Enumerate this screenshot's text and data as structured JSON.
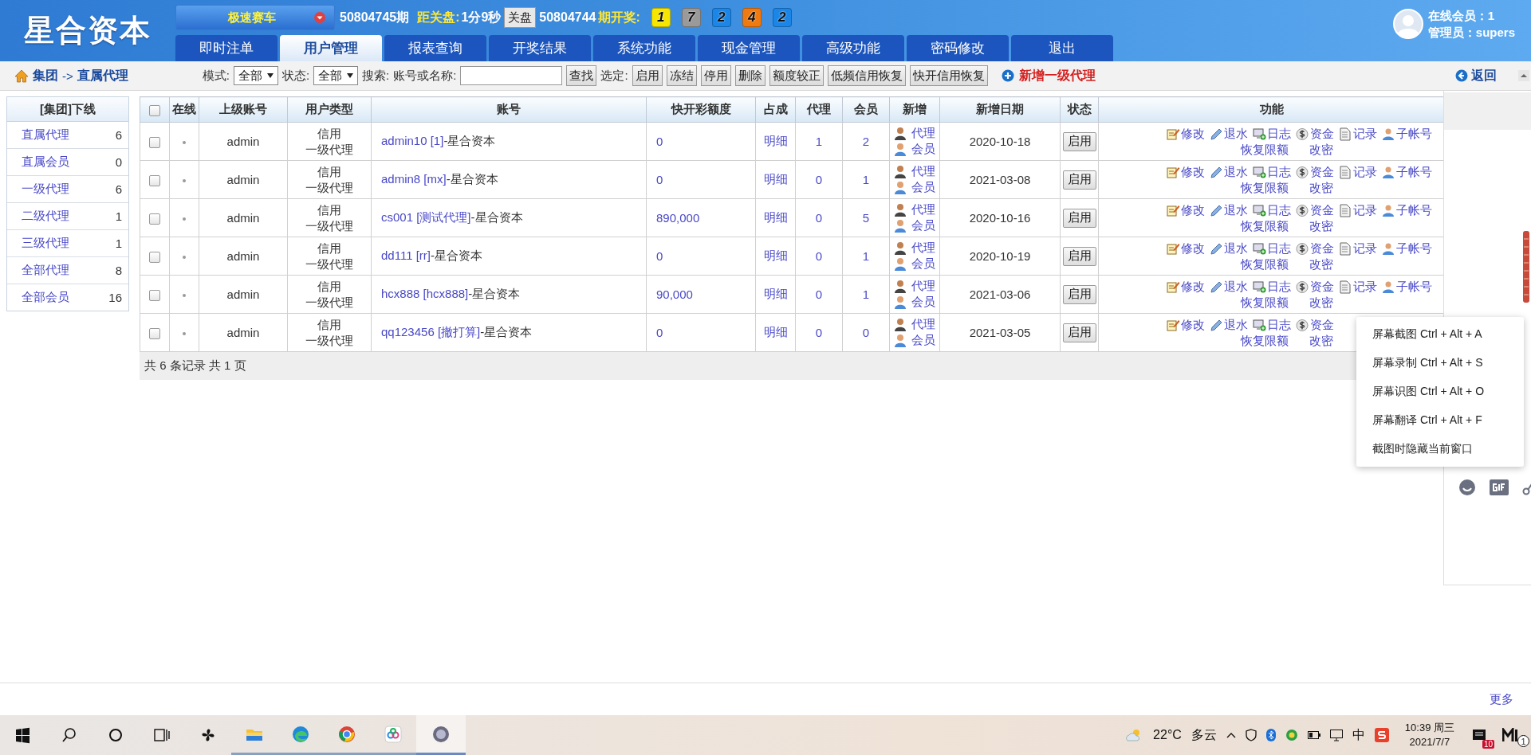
{
  "header": {
    "logo": "星合资本",
    "game": "极速赛车",
    "period": "50804745期",
    "close_label": "距关盘:",
    "countdown": "1分9秒",
    "close_button": "关盘",
    "last_period": "50804744",
    "draw_label": "期开奖:",
    "balls": [
      {
        "text": "1",
        "color": "#f7e600"
      },
      {
        "text": "7",
        "color": "#9a9a9a"
      },
      {
        "text": "2",
        "color": "#1a86e8"
      },
      {
        "text": "4",
        "color": "#f07a10"
      },
      {
        "text": "2",
        "color": "#1a86e8"
      }
    ],
    "online_members": "在线会员：1",
    "admin": "管理员：supers"
  },
  "tabs": [
    {
      "label": "即时注单",
      "selected": false
    },
    {
      "label": "用户管理",
      "selected": true
    },
    {
      "label": "报表查询",
      "selected": false
    },
    {
      "label": "开奖结果",
      "selected": false
    },
    {
      "label": "系统功能",
      "selected": false
    },
    {
      "label": "现金管理",
      "selected": false
    },
    {
      "label": "高级功能",
      "selected": false
    },
    {
      "label": "密码修改",
      "selected": false
    },
    {
      "label": "退出",
      "selected": false
    }
  ],
  "toolbar": {
    "breadcrumb_root": "集团",
    "breadcrumb_separator": "->",
    "breadcrumb_current": "直属代理",
    "mode_label": "模式:",
    "mode_value": "全部",
    "status_label": "状态:",
    "status_value": "全部",
    "search_label": "搜索:",
    "search_field_label": "账号或名称:",
    "search_button": "查找",
    "selected_label": "选定:",
    "actions": [
      "启用",
      "冻结",
      "停用",
      "删除",
      "额度较正",
      "低频信用恢复",
      "快开信用恢复"
    ],
    "add_link": "新增一级代理",
    "back_link": "返回"
  },
  "sidebar": {
    "title": "[集团]下线",
    "items": [
      {
        "label": "直属代理",
        "count": "6"
      },
      {
        "label": "直属会员",
        "count": "0"
      },
      {
        "label": "一级代理",
        "count": "6"
      },
      {
        "label": "二级代理",
        "count": "1"
      },
      {
        "label": "三级代理",
        "count": "1"
      },
      {
        "label": "全部代理",
        "count": "8"
      },
      {
        "label": "全部会员",
        "count": "16"
      }
    ]
  },
  "table": {
    "select_all_checked": false,
    "columns": [
      "在线",
      "上级账号",
      "用户类型",
      "账号",
      "快开彩额度",
      "占成",
      "代理",
      "会员",
      "新增",
      "新增日期",
      "状态",
      "功能"
    ],
    "rows": [
      {
        "checked": false,
        "online": false,
        "parent": "admin",
        "user_type": [
          "信用",
          "一级代理"
        ],
        "account": "admin10 [1]",
        "account_suffix": "-星合资本",
        "quota": "0",
        "share": "明细",
        "agents": "1",
        "members": "2",
        "add_links": [
          "代理",
          "会员"
        ],
        "date": "2020-10-18",
        "status_button": "启用",
        "actions": [
          {
            "kind": "edit",
            "label": "修改"
          },
          {
            "kind": "rebate",
            "label": "退水"
          },
          {
            "kind": "log",
            "label": "日志"
          },
          {
            "kind": "funds",
            "label": "资金"
          },
          {
            "kind": "record",
            "label": "记录"
          },
          {
            "kind": "subaccount",
            "label": "子帐号"
          },
          {
            "kind": "text",
            "label": "恢复限额"
          },
          {
            "kind": "text",
            "label": "改密"
          }
        ]
      },
      {
        "checked": false,
        "online": false,
        "parent": "admin",
        "user_type": [
          "信用",
          "一级代理"
        ],
        "account": "admin8 [mx]",
        "account_suffix": "-星合资本",
        "quota": "0",
        "share": "明细",
        "agents": "0",
        "members": "1",
        "add_links": [
          "代理",
          "会员"
        ],
        "date": "2021-03-08",
        "status_button": "启用",
        "actions": [
          {
            "kind": "edit",
            "label": "修改"
          },
          {
            "kind": "rebate",
            "label": "退水"
          },
          {
            "kind": "log",
            "label": "日志"
          },
          {
            "kind": "funds",
            "label": "资金"
          },
          {
            "kind": "record",
            "label": "记录"
          },
          {
            "kind": "subaccount",
            "label": "子帐号"
          },
          {
            "kind": "text",
            "label": "恢复限额"
          },
          {
            "kind": "text",
            "label": "改密"
          }
        ]
      },
      {
        "checked": false,
        "online": false,
        "parent": "admin",
        "user_type": [
          "信用",
          "一级代理"
        ],
        "account": "cs001 [测试代理]",
        "account_suffix": "-星合资本",
        "quota": "890,000",
        "share": "明细",
        "agents": "0",
        "members": "5",
        "add_links": [
          "代理",
          "会员"
        ],
        "date": "2020-10-16",
        "status_button": "启用",
        "actions": [
          {
            "kind": "edit",
            "label": "修改"
          },
          {
            "kind": "rebate",
            "label": "退水"
          },
          {
            "kind": "log",
            "label": "日志"
          },
          {
            "kind": "funds",
            "label": "资金"
          },
          {
            "kind": "record",
            "label": "记录"
          },
          {
            "kind": "subaccount",
            "label": "子帐号"
          },
          {
            "kind": "text",
            "label": "恢复限额"
          },
          {
            "kind": "text",
            "label": "改密"
          }
        ]
      },
      {
        "checked": false,
        "online": false,
        "parent": "admin",
        "user_type": [
          "信用",
          "一级代理"
        ],
        "account": "dd111 [rr]",
        "account_suffix": "-星合资本",
        "quota": "0",
        "share": "明细",
        "agents": "0",
        "members": "1",
        "add_links": [
          "代理",
          "会员"
        ],
        "date": "2020-10-19",
        "status_button": "启用",
        "actions": [
          {
            "kind": "edit",
            "label": "修改"
          },
          {
            "kind": "rebate",
            "label": "退水"
          },
          {
            "kind": "log",
            "label": "日志"
          },
          {
            "kind": "funds",
            "label": "资金"
          },
          {
            "kind": "record",
            "label": "记录"
          },
          {
            "kind": "subaccount",
            "label": "子帐号"
          },
          {
            "kind": "text",
            "label": "恢复限额"
          },
          {
            "kind": "text",
            "label": "改密"
          }
        ]
      },
      {
        "checked": false,
        "online": false,
        "parent": "admin",
        "user_type": [
          "信用",
          "一级代理"
        ],
        "account": "hcx888 [hcx888]",
        "account_suffix": "-星合资本",
        "quota": "90,000",
        "share": "明细",
        "agents": "0",
        "members": "1",
        "add_links": [
          "代理",
          "会员"
        ],
        "date": "2021-03-06",
        "status_button": "启用",
        "actions": [
          {
            "kind": "edit",
            "label": "修改"
          },
          {
            "kind": "rebate",
            "label": "退水"
          },
          {
            "kind": "log",
            "label": "日志"
          },
          {
            "kind": "funds",
            "label": "资金"
          },
          {
            "kind": "record",
            "label": "记录"
          },
          {
            "kind": "subaccount",
            "label": "子帐号"
          },
          {
            "kind": "text",
            "label": "恢复限额"
          },
          {
            "kind": "text",
            "label": "改密"
          }
        ]
      },
      {
        "checked": false,
        "online": false,
        "parent": "admin",
        "user_type": [
          "信用",
          "一级代理"
        ],
        "account": "qq123456 [撤打算]",
        "account_suffix": "-星合资本",
        "quota": "0",
        "share": "明细",
        "agents": "0",
        "members": "0",
        "add_links": [
          "代理",
          "会员"
        ],
        "date": "2021-03-05",
        "status_button": "启用",
        "actions": [
          {
            "kind": "edit",
            "label": "修改"
          },
          {
            "kind": "rebate",
            "label": "退水"
          },
          {
            "kind": "log",
            "label": "日志"
          },
          {
            "kind": "funds",
            "label": "资金"
          },
          {
            "kind": "text",
            "label": "恢复限额"
          },
          {
            "kind": "text",
            "label": "改密"
          }
        ]
      }
    ],
    "footer": "共 6 条记录 共 1 页"
  },
  "context_menu": [
    {
      "label": "屏幕截图",
      "shortcut": "Ctrl + Alt + A"
    },
    {
      "label": "屏幕录制",
      "shortcut": "Ctrl + Alt + S"
    },
    {
      "label": "屏幕识图",
      "shortcut": "Ctrl + Alt + O"
    },
    {
      "label": "屏幕翻译",
      "shortcut": "Ctrl + Alt + F"
    },
    {
      "label": "截图时隐藏当前窗口"
    }
  ],
  "more_link": "更多",
  "taskbar": {
    "temperature": "22°C",
    "weather": "多云",
    "ime": "中",
    "time": "10:39 周三",
    "date": "2021/7/7",
    "notification_count": "10",
    "app_badge": "1"
  }
}
